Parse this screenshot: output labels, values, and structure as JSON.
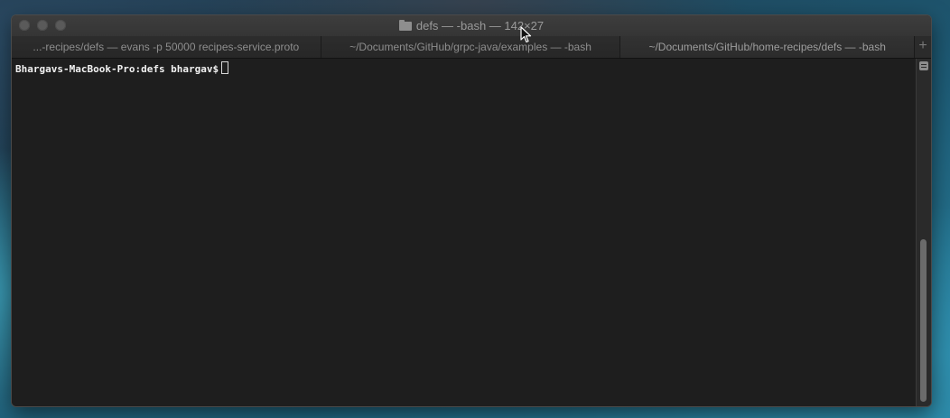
{
  "window": {
    "title": "defs — -bash — 142×27"
  },
  "tabs": [
    {
      "label": "...-recipes/defs — evans -p 50000 recipes-service.proto"
    },
    {
      "label": "~/Documents/GitHub/grpc-java/examples — -bash"
    },
    {
      "label": "~/Documents/GitHub/home-recipes/defs — -bash"
    }
  ],
  "new_tab_label": "+",
  "terminal": {
    "prompt": "Bhargavs-MacBook-Pro:defs bhargav$"
  },
  "icons": {
    "folder": "folder-icon",
    "pointer": "mouse-pointer-icon"
  }
}
